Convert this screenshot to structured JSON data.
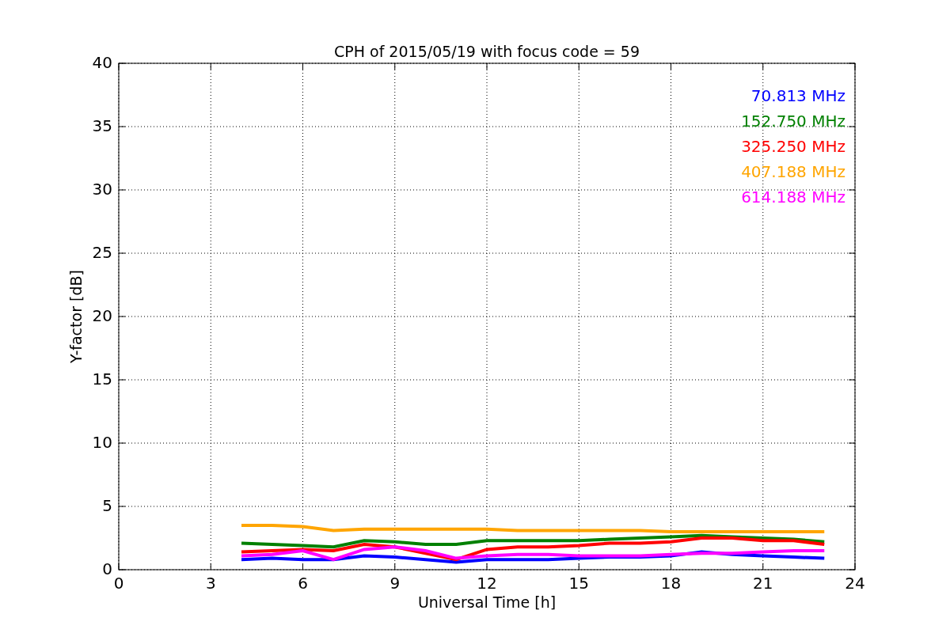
{
  "figure": {
    "chart_data": {
      "type": "line",
      "title": "CPH of 2015/05/19 with focus code = 59",
      "xlabel": "Universal Time [h]",
      "ylabel": "Y-factor [dB]",
      "x": [
        4,
        5,
        6,
        7,
        8,
        9,
        10,
        11,
        12,
        13,
        14,
        15,
        16,
        17,
        18,
        19,
        20,
        21,
        22,
        23
      ],
      "series": [
        {
          "name": "70.813 MHz",
          "color": "#0000ff",
          "values": [
            0.8,
            0.9,
            0.8,
            0.8,
            1.1,
            1.0,
            0.8,
            0.6,
            0.8,
            0.8,
            0.8,
            0.9,
            1.0,
            1.0,
            1.1,
            1.4,
            1.2,
            1.1,
            1.0,
            0.9
          ]
        },
        {
          "name": "152.750 MHz",
          "color": "#008000",
          "values": [
            2.1,
            2.0,
            1.9,
            1.8,
            2.3,
            2.2,
            2.0,
            2.0,
            2.3,
            2.3,
            2.3,
            2.3,
            2.4,
            2.5,
            2.6,
            2.7,
            2.6,
            2.5,
            2.4,
            2.2
          ]
        },
        {
          "name": "325.250 MHz",
          "color": "#ff0000",
          "values": [
            1.4,
            1.5,
            1.6,
            1.5,
            2.0,
            1.8,
            1.3,
            0.8,
            1.6,
            1.8,
            1.8,
            1.9,
            2.1,
            2.1,
            2.2,
            2.5,
            2.5,
            2.3,
            2.3,
            2.0
          ]
        },
        {
          "name": "407.188 MHz",
          "color": "#ffa500",
          "values": [
            3.5,
            3.5,
            3.4,
            3.1,
            3.2,
            3.2,
            3.2,
            3.2,
            3.2,
            3.1,
            3.1,
            3.1,
            3.1,
            3.1,
            3.0,
            3.0,
            3.0,
            3.0,
            3.0,
            3.0
          ]
        },
        {
          "name": "614.188 MHz",
          "color": "#ff00ff",
          "values": [
            1.1,
            1.2,
            1.5,
            0.8,
            1.6,
            1.8,
            1.5,
            0.9,
            1.1,
            1.2,
            1.2,
            1.1,
            1.1,
            1.1,
            1.2,
            1.3,
            1.3,
            1.4,
            1.5,
            1.5
          ]
        }
      ],
      "xlim": [
        0,
        24
      ],
      "ylim": [
        0,
        40
      ],
      "xticks": [
        0,
        3,
        6,
        9,
        12,
        15,
        18,
        21,
        24
      ],
      "yticks": [
        0,
        5,
        10,
        15,
        20,
        25,
        30,
        35,
        40
      ],
      "grid": true
    }
  }
}
